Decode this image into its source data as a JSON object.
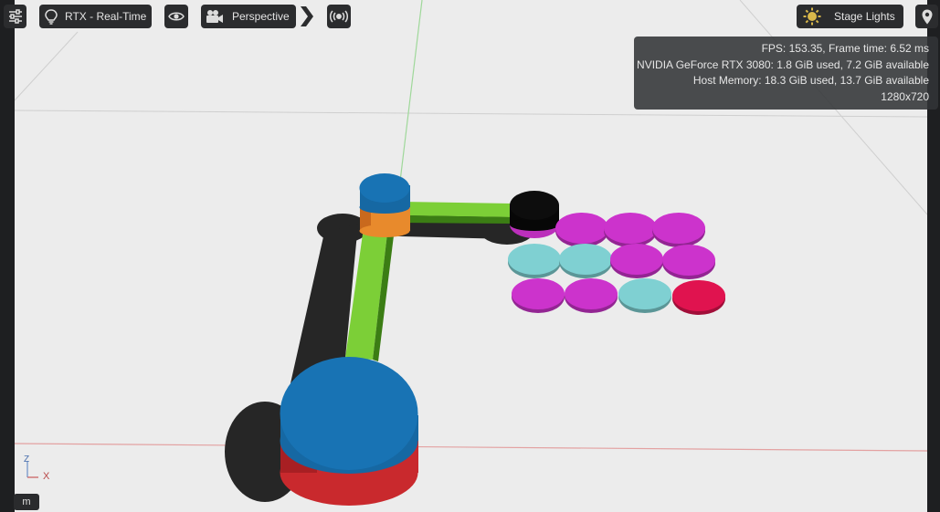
{
  "toolbar": {
    "settings_icon": "sliders-icon",
    "renderer_icon": "lightbulb-icon",
    "renderer_label": "RTX - Real-Time",
    "visibility_icon": "eye-icon",
    "camera_icon": "camera-icon",
    "camera_label": "Perspective",
    "expand_icon": "chevron-right-icon",
    "broadcast_icon": "broadcast-icon",
    "lights_icon": "sun-icon",
    "lights_label": "Stage Lights",
    "pin_icon": "location-pin-icon"
  },
  "stats": {
    "fps_line": "FPS: 153.35, Frame time: 6.52 ms",
    "gpu_line": "NVIDIA GeForce RTX 3080: 1.8 GiB used, 7.2 GiB available",
    "host_line": "Host Memory: 18.3 GiB used, 13.7 GiB available",
    "resolution": "1280x720"
  },
  "axis_gizmo": {
    "z_label": "Z",
    "x_label": "X"
  },
  "unit_badge": "m",
  "colors": {
    "viewport_bg": "#ececec",
    "toolbar_bg": "#2b2c2e",
    "link_green": "#7ccf37",
    "joint_blue": "#1873b4",
    "joint_orange": "#e88a2c",
    "base_red": "#d9383c",
    "puck_magenta": "#cc33cc",
    "puck_cyan": "#7fd0d2",
    "puck_crimson": "#e0134f",
    "gripper_black": "#0b0b0b",
    "grid_green": "#9fd89a",
    "grid_red": "#e3a1a1"
  }
}
